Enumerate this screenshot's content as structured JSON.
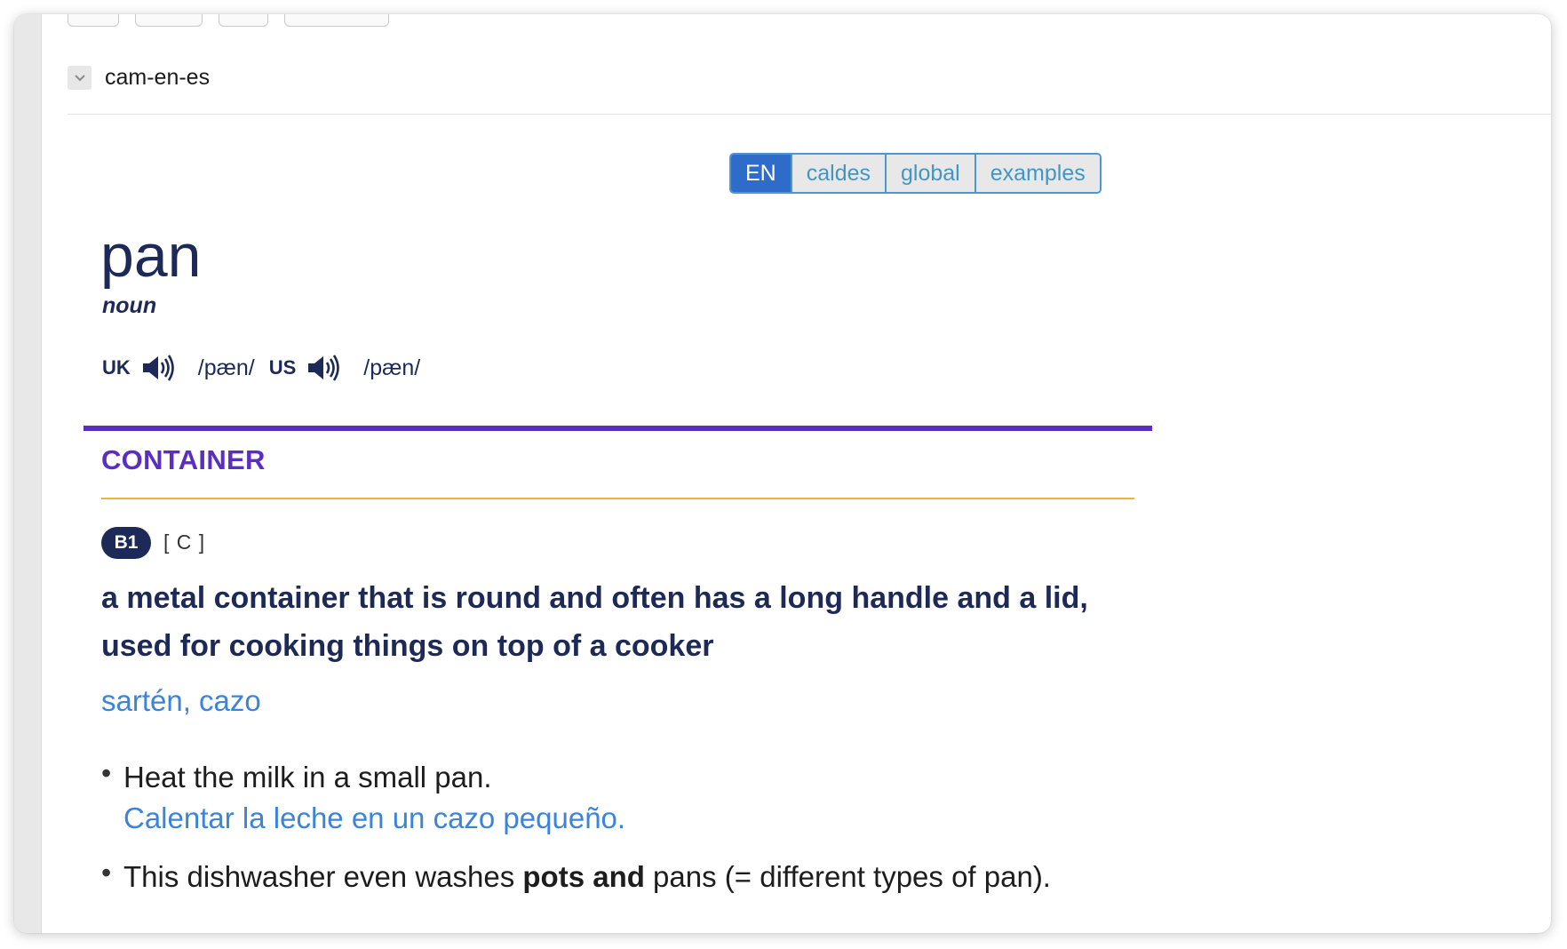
{
  "dictionary": {
    "name": "cam-en-es"
  },
  "lang_tabs": [
    {
      "label": "EN",
      "active": true
    },
    {
      "label": "caldes",
      "active": false
    },
    {
      "label": "global",
      "active": false
    },
    {
      "label": "examples",
      "active": false
    }
  ],
  "entry": {
    "headword": "pan",
    "pos": "noun",
    "pronunciations": [
      {
        "region": "UK",
        "ipa": "/pæn/",
        "icon": "speaker-icon"
      },
      {
        "region": "US",
        "ipa": "/pæn/",
        "icon": "speaker-icon"
      }
    ],
    "sense": {
      "guideword": "CONTAINER",
      "level": "B1",
      "grammar": "[ C ]",
      "definition": "a metal container that is round and often has a long handle and a lid, used for cooking things on top of a cooker",
      "translation": "sartén, cazo",
      "examples": [
        {
          "text": "Heat the milk in a small pan.",
          "translation": "Calentar la leche en un cazo pequeño."
        },
        {
          "text_before": "This dishwasher even washes ",
          "text_bold": "pots and",
          "text_after": " pans (= different types of pan)."
        }
      ]
    }
  },
  "colors": {
    "headword": "#1d2a57",
    "guideword": "#5a2ec1",
    "guide_underline": "#f4b03b",
    "translation": "#3c84d9",
    "tab_active_bg": "#2f6cc9",
    "tab_border": "#4a96d6"
  }
}
